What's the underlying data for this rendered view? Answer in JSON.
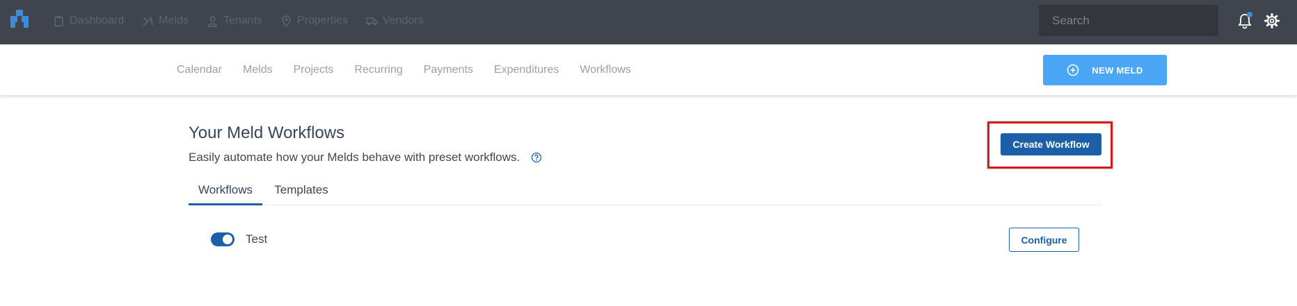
{
  "topnav": {
    "items": [
      {
        "label": "Dashboard",
        "icon": "clipboard-icon"
      },
      {
        "label": "Melds",
        "icon": "tools-icon"
      },
      {
        "label": "Tenants",
        "icon": "person-icon"
      },
      {
        "label": "Properties",
        "icon": "map-pin-icon"
      },
      {
        "label": "Vendors",
        "icon": "truck-icon"
      }
    ],
    "search_placeholder": "Search"
  },
  "subnav": {
    "links": [
      "Calendar",
      "Melds",
      "Projects",
      "Recurring",
      "Payments",
      "Expenditures",
      "Workflows"
    ],
    "new_meld_label": "NEW MELD"
  },
  "main": {
    "title": "Your Meld Workflows",
    "subtitle": "Easily automate how your Melds behave with preset workflows.",
    "create_button": "Create Workflow",
    "tabs": [
      {
        "label": "Workflows",
        "active": true
      },
      {
        "label": "Templates",
        "active": false
      }
    ],
    "workflows": [
      {
        "name": "Test",
        "enabled": true,
        "action": "Configure"
      }
    ]
  },
  "colors": {
    "topbar": "#40444d",
    "primary": "#1a5fa8",
    "new_meld": "#4ba7f5",
    "highlight": "#d61a1a"
  }
}
